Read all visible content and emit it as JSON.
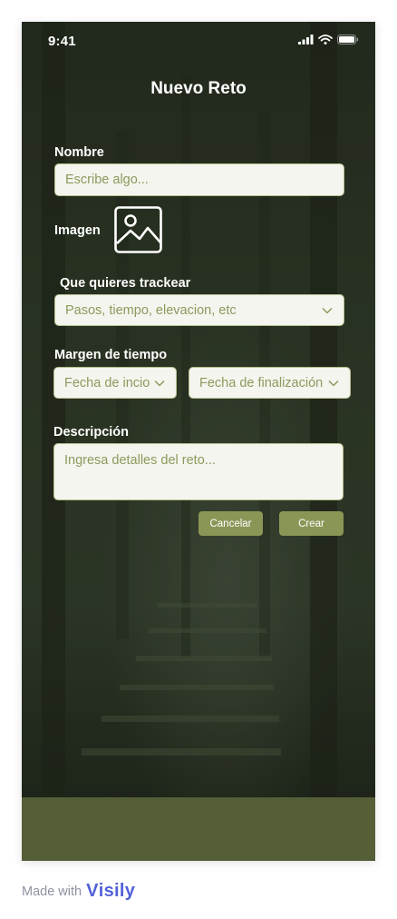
{
  "status_bar": {
    "time": "9:41"
  },
  "header": {
    "title": "Nuevo Reto"
  },
  "form": {
    "name": {
      "label": "Nombre",
      "placeholder": "Escribe algo..."
    },
    "image": {
      "label": "Imagen",
      "icon": "image-placeholder-icon"
    },
    "track": {
      "label": "Que quieres trackear",
      "value": "Pasos, tiempo, elevacion, etc"
    },
    "time_range": {
      "label": "Margen de tiempo",
      "start": "Fecha de incio",
      "end": "Fecha de finalización"
    },
    "description": {
      "label": "Descripción",
      "placeholder": "Ingresa detalles del reto..."
    },
    "cancel_label": "Cancelar",
    "create_label": "Crear"
  },
  "footer": {
    "made_with": "Made with",
    "brand": "isily",
    "brand_mark": "V"
  },
  "colors": {
    "accent": "#8a9656",
    "field_bg": "#f4f5ee",
    "placeholder": "#8b9a5d",
    "bottom_bar": "#545e37",
    "brand": "#5161d8"
  }
}
